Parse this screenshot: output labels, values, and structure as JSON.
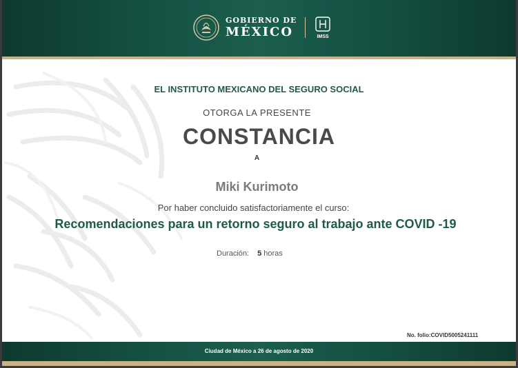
{
  "header": {
    "gob_top": "GOBIERNO DE",
    "gob_main": "MÉXICO",
    "imss_label": "IMSS",
    "colors": {
      "green": "#155244",
      "gold": "#c8b28a"
    }
  },
  "body": {
    "institution": "EL INSTITUTO MEXICANO DEL SEGURO SOCIAL",
    "grants": "OTORGA LA PRESENTE",
    "title": "CONSTANCIA",
    "to": "A",
    "recipient": "Miki Kurimoto",
    "reason": "Por haber concluido satisfactoriamente el curso:",
    "course": "Recomendaciones para un retorno seguro al trabajo ante COVID -19",
    "duration_label": "Duración:",
    "duration_value": "5",
    "duration_unit": "horas",
    "folio": "No. folio:COVID5005241111"
  },
  "footer": {
    "place_date": "Ciudad de México a 26 de agosto de 2020"
  }
}
